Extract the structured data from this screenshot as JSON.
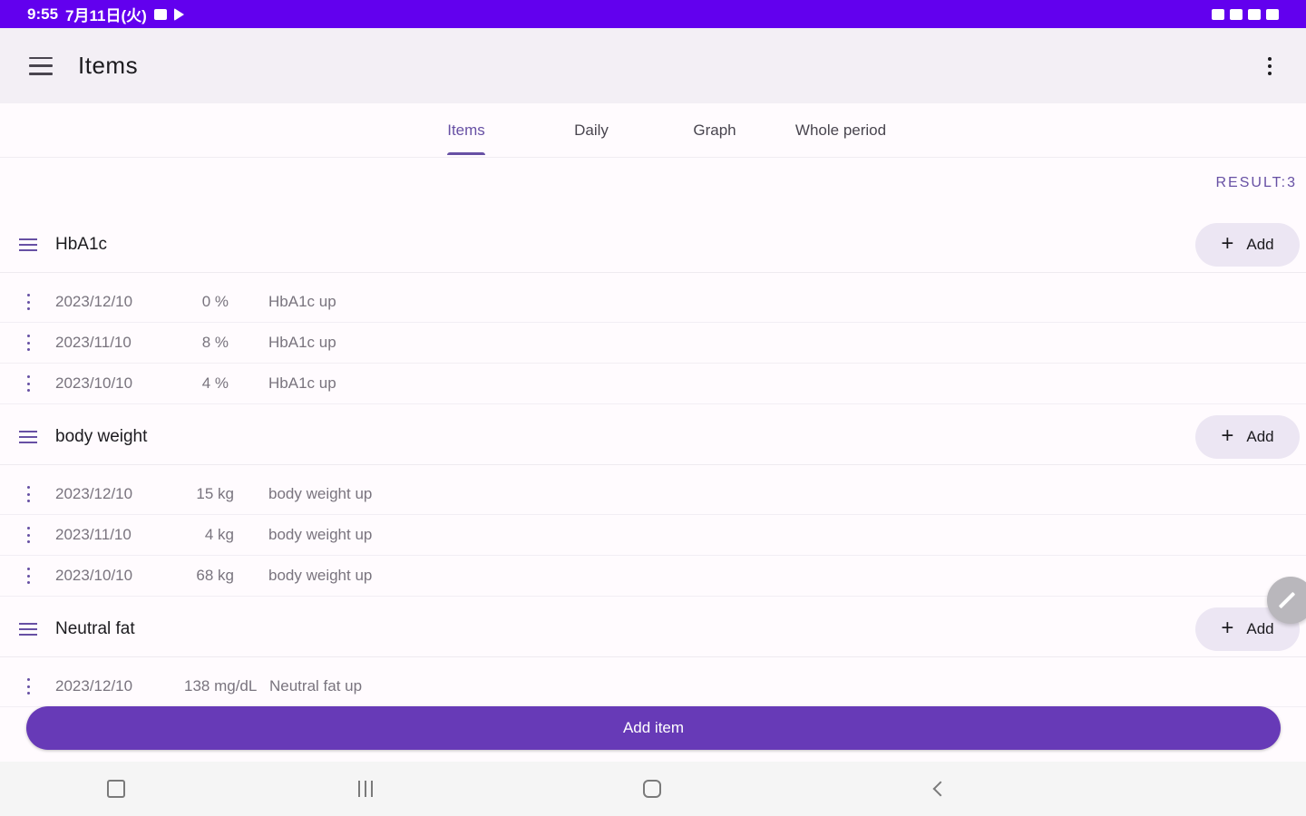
{
  "status_bar": {
    "time": "9:55",
    "date": "7月11日(火)"
  },
  "app_bar": {
    "title": "Items"
  },
  "tabs": [
    {
      "label": "Items",
      "active": true
    },
    {
      "label": "Daily",
      "active": false
    },
    {
      "label": "Graph",
      "active": false
    },
    {
      "label": "Whole period",
      "active": false
    }
  ],
  "result": "RESULT:3",
  "groups": [
    {
      "name": "HbA1c",
      "add_label": "Add",
      "rows": [
        {
          "date": "2023/12/10",
          "value": "0 %",
          "note": "HbA1c up"
        },
        {
          "date": "2023/11/10",
          "value": "8 %",
          "note": "HbA1c up"
        },
        {
          "date": "2023/10/10",
          "value": "4 %",
          "note": "HbA1c up"
        }
      ]
    },
    {
      "name": "body weight",
      "add_label": "Add",
      "rows": [
        {
          "date": "2023/12/10",
          "value": "15 kg",
          "note": "body weight up"
        },
        {
          "date": "2023/11/10",
          "value": "4 kg",
          "note": "body weight up"
        },
        {
          "date": "2023/10/10",
          "value": "68 kg",
          "note": "body weight up"
        }
      ]
    },
    {
      "name": "Neutral fat",
      "add_label": "Add",
      "rows": [
        {
          "date": "2023/12/10",
          "value": "138 mg/dL",
          "note": "Neutral fat up"
        }
      ]
    }
  ],
  "primary_button": {
    "label": "Add item"
  },
  "colors": {
    "status_bar": "#6200ee",
    "primary": "#673ab7",
    "accent": "#6750a4"
  },
  "icons": [
    "menu-icon",
    "overflow-menu-icon",
    "drag-handle-icon",
    "row-menu-icon",
    "plus-icon",
    "edit-icon",
    "recent-apps-icon",
    "home-icon",
    "back-icon"
  ]
}
